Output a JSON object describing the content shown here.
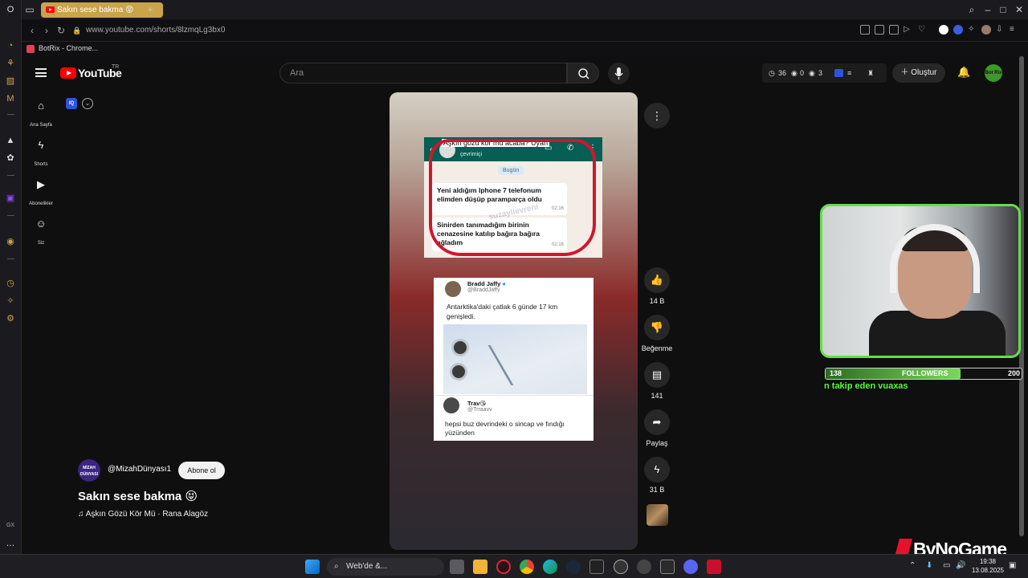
{
  "browser": {
    "tab_title": "Sakın sese bakma 😝",
    "url": "www.youtube.com/shorts/8lzmqLg3bx0",
    "bookmark": "BotRix - Chrome..."
  },
  "youtube": {
    "logo_text": "YouTube",
    "country_code": "TR",
    "search_placeholder": "Ara",
    "stats": {
      "a": "36",
      "b": "0",
      "c": "3"
    },
    "create_label": "Oluştur",
    "avatar_text": "Bot Rix",
    "guide": [
      {
        "label": "Ana Sayfa",
        "icon": "home-icon"
      },
      {
        "label": "Shorts",
        "icon": "shorts-icon"
      },
      {
        "label": "Abonelikler",
        "icon": "subscriptions-icon"
      },
      {
        "label": "Siz",
        "icon": "you-icon"
      }
    ]
  },
  "short": {
    "whatsapp": {
      "caption": "Aşkın gözü kör mü acaba? Uyan",
      "status": "çevrimiçi",
      "date": "Bugün",
      "watermark": "suzaylievreni",
      "messages": [
        {
          "text": "Yeni aldığım Iphone 7 telefonum elimden düşüp paramparça oldu",
          "time": "02:16"
        },
        {
          "text": "Sinirden tanımadığım birinin cenazesine katılıp bağıra bağıra ağladım",
          "time": "02:16"
        }
      ]
    },
    "tweet": {
      "name": "Bradd Jaffy",
      "handle": "@BraddJaffy",
      "text": "Antarktika'daki çatlak 6 günde 17 km genişledi.",
      "reply_name": "Trav😘",
      "reply_handle": "@Trraavv",
      "reply_text": "hepsi buz devrindeki o sincap ve fındığı yüzünden"
    },
    "actions": {
      "likes": "14 B",
      "dislike_label": "Beğenme",
      "comments": "141",
      "share_label": "Paylaş",
      "remix": "31 B"
    },
    "channel": {
      "name": "@MizahDünyası1",
      "avatar_text": "MİZAH DÜNYASI",
      "subscribe_label": "Abone ol"
    },
    "title": "Sakın sese bakma 😝",
    "music": "Aşkın Gözü Kör Mü · Rana Alagöz"
  },
  "stream_overlay": {
    "followers_current": "138",
    "followers_label": "FOLLOWERS",
    "followers_goal": "200",
    "followers_progress": 0.69,
    "alert": "n takip eden vuaxas",
    "brand": "ByNoGame"
  },
  "taskbar": {
    "search_label": "Web'de &...",
    "time": "19:38",
    "date": "13.08.2025"
  },
  "colors": {
    "accent_tab": "#c9a44a",
    "youtube_red": "#ff0000",
    "overlay_green": "#63e04a"
  }
}
